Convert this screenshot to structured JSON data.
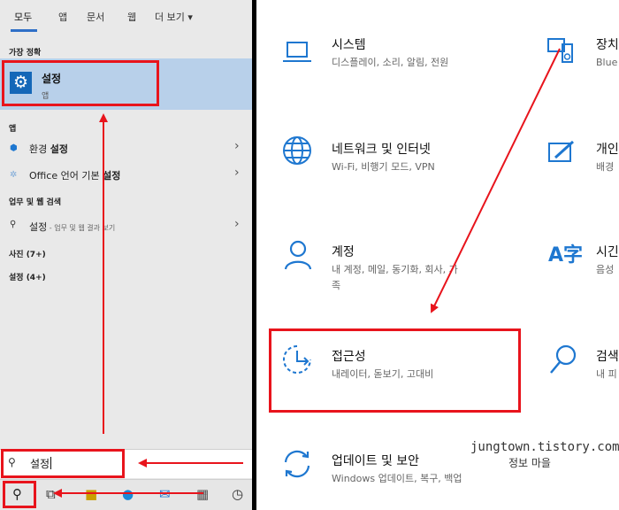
{
  "search_panel": {
    "tabs": [
      "모두",
      "앱",
      "문서",
      "웹",
      "더 보기 ▾"
    ],
    "best_match_header": "가장 정확",
    "best_match": {
      "title": "설정",
      "subtitle": "앱"
    },
    "apps_header": "앱",
    "apps": [
      {
        "prefix": "환경 ",
        "bold": "설정"
      },
      {
        "prefix": "Office 언어 기본 ",
        "bold": "설정"
      }
    ],
    "web_header": "업무 및 웹 검색",
    "web_item": {
      "text": "설정",
      "suffix": " - 업무 및 웹 결과 보기"
    },
    "photos_header": "사진 (7+)",
    "settings_header": "설정 (4+)",
    "search_query": "설정",
    "chevron": "›",
    "icons": {
      "app": "gear-icon",
      "env": "shield-icon",
      "office": "globe-icon",
      "search": "search-icon",
      "taskview": "task-view-icon",
      "edge": "edge-icon",
      "calculator": "calculator-icon",
      "clock": "clock-icon"
    }
  },
  "settings": {
    "items": [
      {
        "title": "시스템",
        "desc": "디스플레이, 소리, 알림, 전원",
        "icon": "laptop-icon"
      },
      {
        "title": "장치",
        "desc": "Blue",
        "icon": "device-icon"
      },
      {
        "title": "네트워크 및 인터넷",
        "desc": "Wi-Fi, 비행기 모드, VPN",
        "icon": "globe-icon"
      },
      {
        "title": "개인",
        "desc": "배경",
        "icon": "paint-icon"
      },
      {
        "title": "계정",
        "desc_lines": [
          "내 계정, 메일, 동기화, 회사, 가",
          "족"
        ],
        "icon": "person-icon"
      },
      {
        "title": "시긴",
        "desc": "음성",
        "icon": "language-icon"
      },
      {
        "title": "접근성",
        "desc": "내레이터, 돋보기, 고대비",
        "icon": "ease-of-access-icon"
      },
      {
        "title": "검색",
        "desc": "내 피",
        "icon": "search-icon"
      },
      {
        "title": "업데이트 및 보안",
        "desc": "Windows 업데이트, 복구, 백업",
        "icon": "sync-icon"
      }
    ]
  },
  "watermark": {
    "line1": "jungtown.tistory.com",
    "line2": "정보 마을"
  },
  "colors": {
    "accent": "#1e77d0",
    "annotation": "#e8141c",
    "highlight": "#b8d0ea"
  }
}
